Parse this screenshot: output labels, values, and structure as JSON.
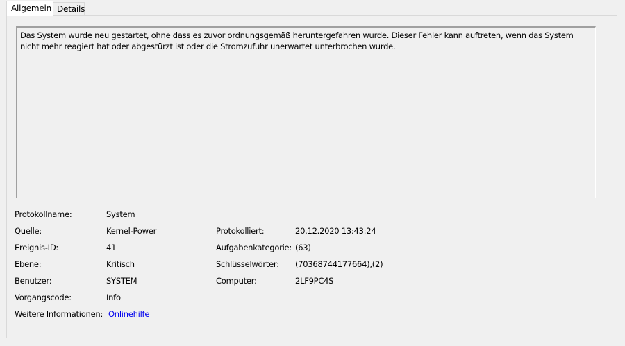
{
  "tabs": [
    {
      "label": "Allgemein",
      "active": true
    },
    {
      "label": "Details",
      "active": false
    }
  ],
  "description": "Das System wurde neu gestartet, ohne dass es zuvor ordnungsgemäß heruntergefahren wurde. Dieser Fehler kann auftreten, wenn das System nicht mehr reagiert hat oder abgestürzt ist oder die Stromzufuhr unerwartet unterbrochen wurde.",
  "fields": {
    "log_name": {
      "label": "Protokollname:",
      "value": "System"
    },
    "source": {
      "label": "Quelle:",
      "value": "Kernel-Power"
    },
    "logged": {
      "label": "Protokolliert:",
      "value": "20.12.2020 13:43:24"
    },
    "event_id": {
      "label": "Ereignis-ID:",
      "value": "41"
    },
    "task_category": {
      "label": "Aufgabenkategorie:",
      "value": "(63)"
    },
    "level": {
      "label": "Ebene:",
      "value": "Kritisch"
    },
    "keywords": {
      "label": "Schlüsselwörter:",
      "value": "(70368744177664),(2)"
    },
    "user": {
      "label": "Benutzer:",
      "value": "SYSTEM"
    },
    "computer": {
      "label": "Computer:",
      "value": "2LF9PC4S"
    },
    "opcode": {
      "label": "Vorgangscode:",
      "value": "Info"
    },
    "more_info": {
      "label": "Weitere Informationen:",
      "value": "Onlinehilfe"
    }
  },
  "colors": {
    "background": "#f0f0f0",
    "link": "#0000ee",
    "border": "#d9d9d9"
  }
}
